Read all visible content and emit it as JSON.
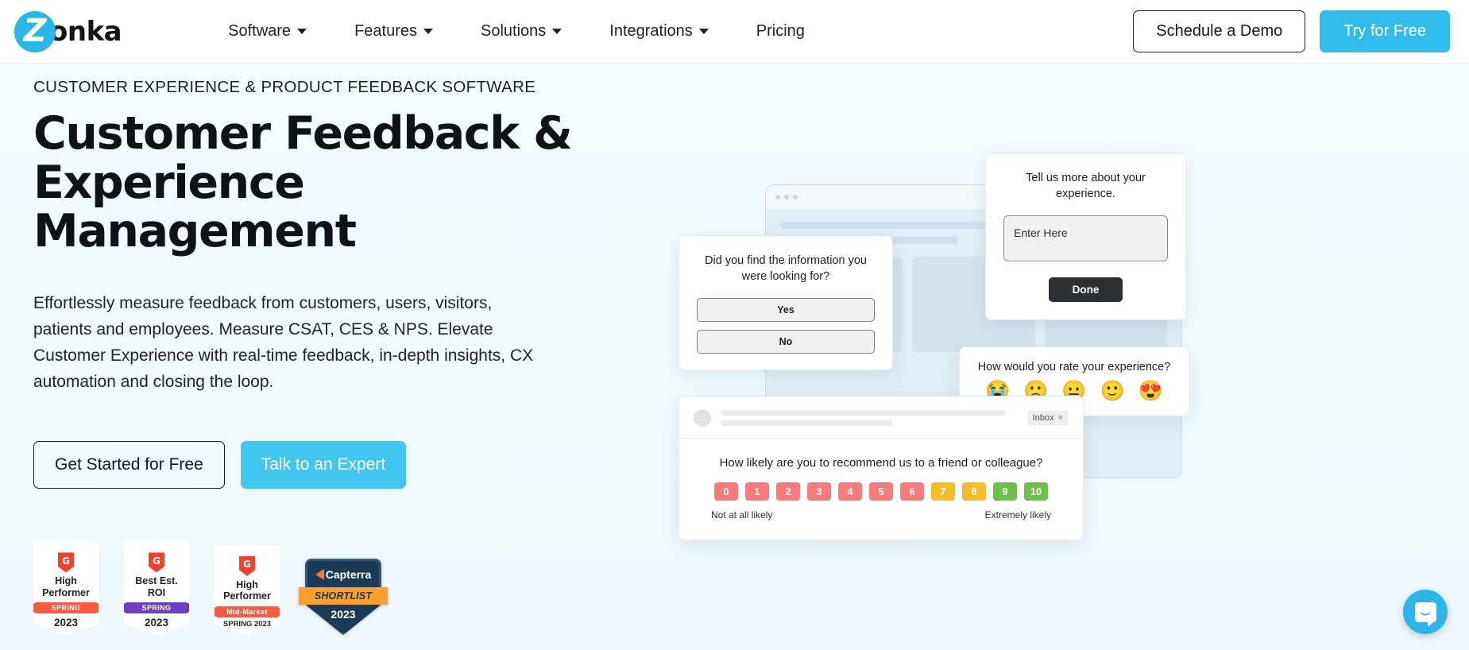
{
  "header": {
    "logo": {
      "mark": "Z",
      "text": "onka"
    },
    "nav": [
      {
        "label": "Software",
        "has_dropdown": true
      },
      {
        "label": "Features",
        "has_dropdown": true
      },
      {
        "label": "Solutions",
        "has_dropdown": true
      },
      {
        "label": "Integrations",
        "has_dropdown": true
      },
      {
        "label": "Pricing",
        "has_dropdown": false
      }
    ],
    "schedule_demo_label": "Schedule a Demo",
    "try_free_label": "Try for Free"
  },
  "hero": {
    "eyebrow": "CUSTOMER EXPERIENCE & PRODUCT FEEDBACK SOFTWARE",
    "title_line1": "Customer Feedback &",
    "title_line2": "Experience Management",
    "subtitle": "Effortlessly measure feedback from customers, users, visitors, patients and employees. Measure CSAT, CES & NPS. Elevate Customer Experience with real-time feedback, in-depth insights, CX automation and closing the loop.",
    "cta_primary": "Talk to an Expert",
    "cta_secondary": "Get Started for Free"
  },
  "badges": [
    {
      "brand": "G2",
      "title": "High Performer",
      "ribbon": "SPRING",
      "ribbon_color": "#fb5a3c",
      "year": "2023",
      "sub": ""
    },
    {
      "brand": "G2",
      "title": "Best Est. ROI",
      "ribbon": "SPRING",
      "ribbon_color": "#6b3fc4",
      "year": "2023",
      "sub": ""
    },
    {
      "brand": "G2",
      "title": "High Performer",
      "ribbon": "Mid-Market",
      "ribbon_color": "#fb5a3c",
      "year": "",
      "sub": "SPRING 2023"
    },
    {
      "brand": "Capterra",
      "title": "Capterra",
      "ribbon": "SHORTLIST",
      "ribbon_color": "#f8a130",
      "year": "2023",
      "sub": ""
    }
  ],
  "widgets": {
    "find_info": {
      "question": "Did you find the information you were looking for?",
      "options": [
        "Yes",
        "No"
      ]
    },
    "tell_more": {
      "question": "Tell us more about your experience.",
      "input_placeholder": "Enter Here",
      "submit_label": "Done"
    },
    "emoji_rating": {
      "question": "How would you rate your experience?",
      "emojis": [
        "😭",
        "🙁",
        "😐",
        "🙂",
        "😍"
      ],
      "names": [
        "crying-face",
        "frowning-face",
        "neutral-face",
        "slightly-smiling-face",
        "heart-eyes-face"
      ]
    },
    "nps": {
      "inbox_label": "Inbox",
      "close_label": "×",
      "question": "How likely are you to recommend us to a friend or colleague?",
      "scale": [
        "0",
        "1",
        "2",
        "3",
        "4",
        "5",
        "6",
        "7",
        "8",
        "9",
        "10"
      ],
      "colors": [
        "#f97a7a",
        "#f97a7a",
        "#f97a7a",
        "#f97a7a",
        "#f97a7a",
        "#f97a7a",
        "#f97a7a",
        "#f4bd25",
        "#f4bd25",
        "#6cc04a",
        "#6cc04a"
      ],
      "label_low": "Not at all likely",
      "label_high": "Extremely likely"
    }
  },
  "chat": {
    "name": "chat-widget"
  },
  "colors": {
    "accent": "#31bdeb",
    "hero_bg": "#f2fbfe",
    "text": "#0f1216",
    "detractor": "#f97a7a",
    "passive": "#f4bd25",
    "promoter": "#6cc04a"
  }
}
